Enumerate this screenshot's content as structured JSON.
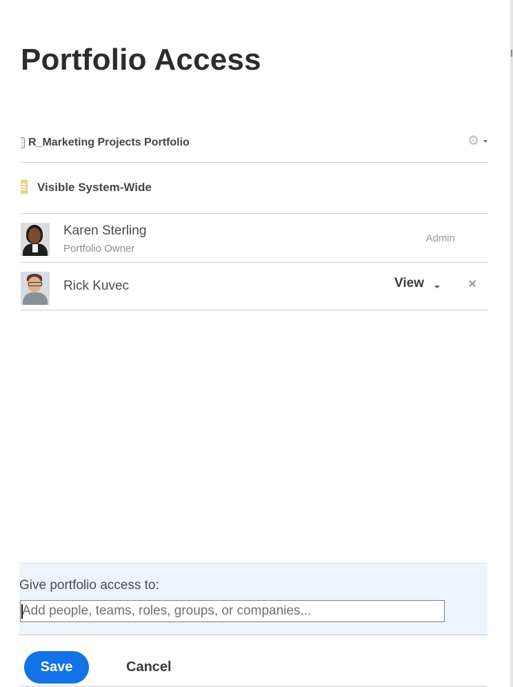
{
  "dialog": {
    "title": "Portfolio Access"
  },
  "portfolio": {
    "name": "R_Marketing Projects Portfolio",
    "icon": "portfolio-icon",
    "settings_icon": "gear-icon"
  },
  "visibility": {
    "label": "Visible System-Wide",
    "icon": "visibility-icon"
  },
  "people": [
    {
      "name": "Karen Sterling",
      "subtitle": "Portfolio Owner",
      "access": "Admin"
    },
    {
      "name": "Rick Kuvec",
      "access": "View",
      "remove_icon": "close-icon"
    }
  ],
  "share": {
    "label": "Give portfolio access to:",
    "placeholder": "Add people, teams, roles, groups, or companies...",
    "value": ""
  },
  "actions": {
    "save": "Save",
    "cancel": "Cancel"
  },
  "colors": {
    "primary": "#1473e6",
    "panel_bg": "#edf4fc",
    "text": "#3b3b3b",
    "muted": "#8c8c8c"
  }
}
